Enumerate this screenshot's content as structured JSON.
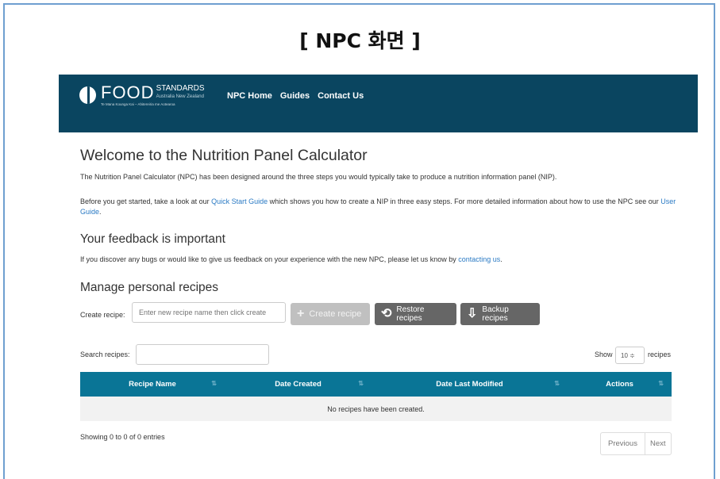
{
  "caption": "[ NPC 화면 ]",
  "header": {
    "logo_food": "FOOD",
    "logo_standards": "STANDARDS",
    "logo_sub": "Australia New Zealand",
    "logo_tag": "Te Mana Kounga Kai – Ahitereiria me Aotearoa",
    "nav": [
      "NPC Home",
      "Guides",
      "Contact Us"
    ]
  },
  "welcome": {
    "title": "Welcome to the Nutrition Panel Calculator",
    "intro": "The Nutrition Panel Calculator (NPC) has been designed around the three steps you would typically take to produce a nutrition information panel (NIP).",
    "p2_a": "Before you get started, take a look at our ",
    "p2_link1": "Quick Start Guide",
    "p2_b": " which shows you how to create a NIP in three easy steps. For more detailed information about how to use the NPC see our ",
    "p2_link2": "User Guide",
    "p2_c": "."
  },
  "feedback": {
    "title": "Your feedback is important",
    "text_a": "If you discover any bugs or would like to give us feedback on your experience with the new NPC, please let us know by ",
    "link": "contacting us",
    "text_b": "."
  },
  "recipes": {
    "title": "Manage personal recipes",
    "create_label": "Create recipe:",
    "create_placeholder": "Enter new recipe name then click create",
    "create_button": "Create recipe",
    "restore_button": "Restore recipes",
    "backup_button": "Backup recipes",
    "search_label": "Search recipes:",
    "show_label": "Show",
    "show_value": "10 ≑",
    "show_suffix": "recipes"
  },
  "table": {
    "columns": [
      "Recipe Name",
      "Date Created",
      "Date Last Modified",
      "Actions"
    ],
    "sort_icon": "⇅",
    "empty_message": "No recipes have been created.",
    "showing": "Showing 0 to 0 of 0 entries",
    "prev": "Previous",
    "next": "Next"
  },
  "colors": {
    "nav_bg": "#0a4560",
    "table_head": "#0a7596",
    "link": "#2a7ac4",
    "frame": "#6f9fd0"
  }
}
